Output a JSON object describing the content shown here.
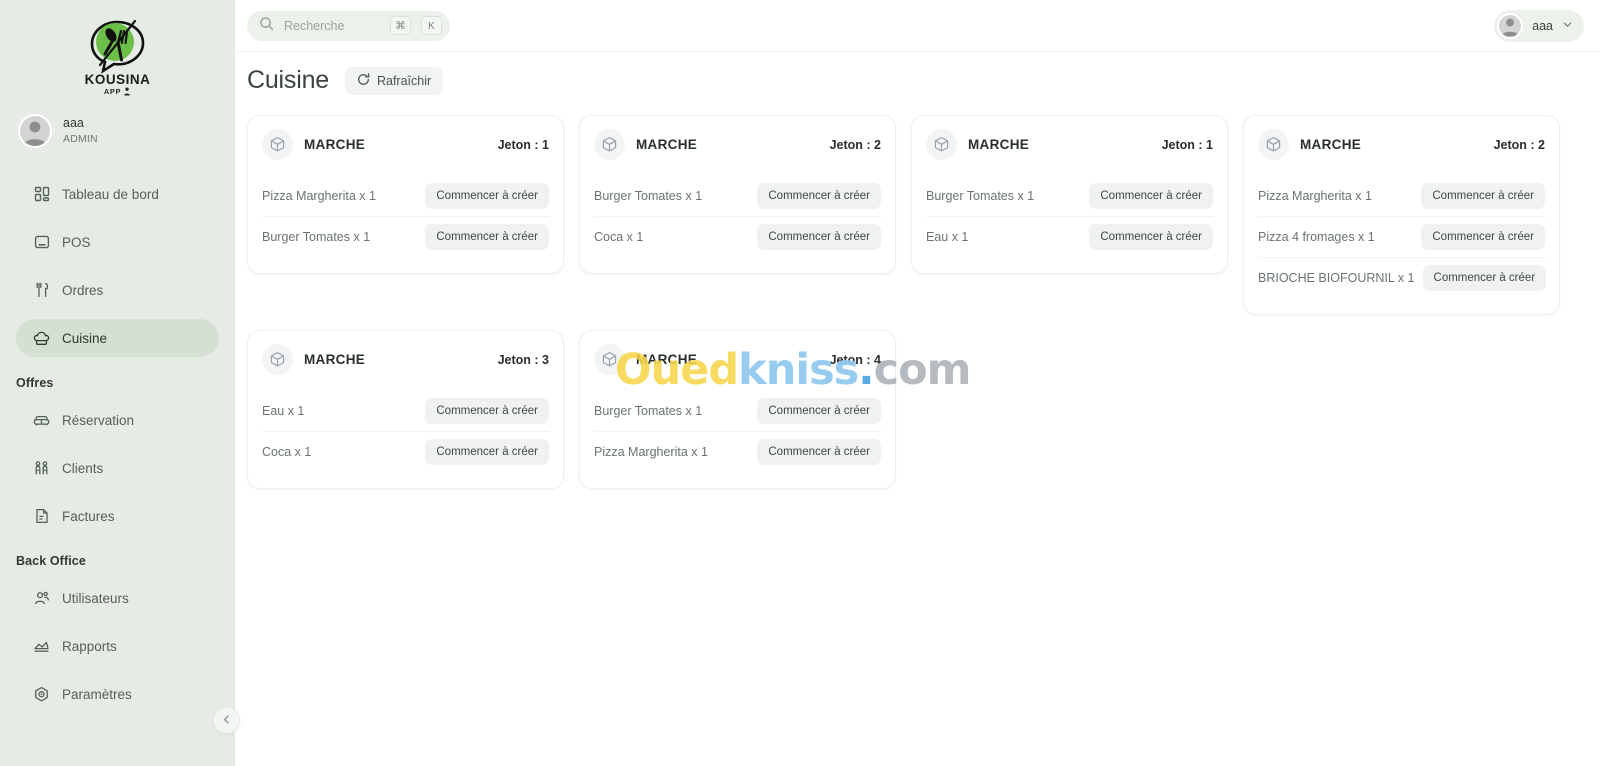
{
  "brand": {
    "name": "KOUSINA",
    "sub": "APP",
    "logo_green": "#6cc04a"
  },
  "profile": {
    "name": "aaa",
    "role": "ADMIN"
  },
  "sidebar": {
    "items": [
      {
        "label": "Tableau de bord",
        "icon": "dashboard-icon",
        "active": false
      },
      {
        "label": "POS",
        "icon": "pos-icon",
        "active": false
      },
      {
        "label": "Ordres",
        "icon": "cutlery-icon",
        "active": false
      },
      {
        "label": "Cuisine",
        "icon": "chef-hat-icon",
        "active": true
      }
    ],
    "section_offres": {
      "title": "Offres",
      "items": [
        {
          "label": "Réservation",
          "icon": "sofa-icon"
        },
        {
          "label": "Clients",
          "icon": "users-icon"
        },
        {
          "label": "Factures",
          "icon": "invoice-icon"
        }
      ]
    },
    "section_back_office": {
      "title": "Back Office",
      "items": [
        {
          "label": "Utilisateurs",
          "icon": "user-group-icon"
        },
        {
          "label": "Rapports",
          "icon": "chart-icon"
        },
        {
          "label": "Paramètres",
          "icon": "settings-icon"
        }
      ]
    },
    "collapse": "chevron-left-icon"
  },
  "topbar": {
    "search": {
      "placeholder": "Recherche",
      "kbd1": "⌘",
      "kbd2": "K"
    },
    "user": {
      "name": "aaa",
      "chevron": "chevron-down-icon"
    }
  },
  "page": {
    "title": "Cuisine",
    "refresh_label": "Rafraîchir"
  },
  "orders": [
    {
      "title": "MARCHE",
      "jeton": "Jeton : 1",
      "lines": [
        {
          "label": "Pizza Margherita x 1",
          "action": "Commencer à créer"
        },
        {
          "label": "Burger Tomates x 1",
          "action": "Commencer à créer"
        }
      ]
    },
    {
      "title": "MARCHE",
      "jeton": "Jeton : 2",
      "lines": [
        {
          "label": "Burger Tomates x 1",
          "action": "Commencer à créer"
        },
        {
          "label": "Coca x 1",
          "action": "Commencer à créer"
        }
      ]
    },
    {
      "title": "MARCHE",
      "jeton": "Jeton : 1",
      "lines": [
        {
          "label": "Burger Tomates x 1",
          "action": "Commencer à créer"
        },
        {
          "label": "Eau x 1",
          "action": "Commencer à créer"
        }
      ]
    },
    {
      "title": "MARCHE",
      "jeton": "Jeton : 2",
      "lines": [
        {
          "label": "Pizza Margherita x 1",
          "action": "Commencer à créer"
        },
        {
          "label": "Pizza 4 fromages x 1",
          "action": "Commencer à créer"
        },
        {
          "label": "BRIOCHE BIOFOURNIL x 1",
          "action": "Commencer à créer"
        }
      ]
    },
    {
      "title": "MARCHE",
      "jeton": "Jeton : 3",
      "lines": [
        {
          "label": "Eau x 1",
          "action": "Commencer à créer"
        },
        {
          "label": "Coca x 1",
          "action": "Commencer à créer"
        }
      ]
    },
    {
      "title": "MARCHE",
      "jeton": "Jeton : 4",
      "lines": [
        {
          "label": "Burger Tomates x 1",
          "action": "Commencer à créer"
        },
        {
          "label": "Pizza Margherita x 1",
          "action": "Commencer à créer"
        }
      ]
    }
  ],
  "watermark": {
    "part1": "O",
    "part2": "ued",
    "part3": "kniss",
    "part4": ".",
    "part5": "com"
  }
}
